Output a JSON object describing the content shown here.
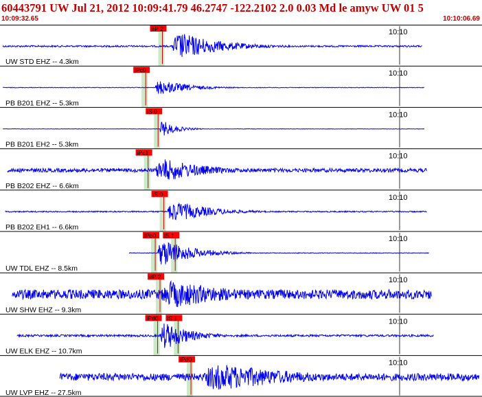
{
  "header": {
    "title": "60443791 UW Jul 21, 2012 10:09:41.79   46.2747 -122.2102  2.0 0.03 Md le amyw UW 01    5",
    "time_start": "10:09:32.65",
    "time_end": "10:10:06.69"
  },
  "colors": {
    "trace": "#0000ee",
    "pick_label_bg": "#ff0000",
    "pick_line": "#cc0000",
    "window_shading": "#cde8c8",
    "title_text": "#c00000",
    "panel_border": "#000000"
  },
  "tick_label": "10:10",
  "traces": [
    {
      "station": "UW STD EHZ -- 4.3km",
      "picks": [
        {
          "label": "eP 2",
          "t": 0.335
        }
      ],
      "onset": 0.355,
      "coda_end": 0.62,
      "quake_amp": 1.0,
      "noise_amp": 0.08,
      "trace_start": 0.0,
      "trace_end": 0.88
    },
    {
      "station": "PB B201 EHZ -- 5.3km",
      "picks": [
        {
          "label": "iPc0",
          "t": 0.3
        }
      ],
      "onset": 0.32,
      "coda_end": 0.5,
      "quake_amp": 0.55,
      "noise_amp": 0.03,
      "trace_start": 0.0,
      "trace_end": 0.885
    },
    {
      "station": "PB B201 EH2 -- 5.3km",
      "picks": [
        {
          "label": "iS 0",
          "t": 0.326
        }
      ],
      "onset": 0.33,
      "coda_end": 0.42,
      "quake_amp": 0.6,
      "noise_amp": 0.02,
      "trace_start": 0.0,
      "trace_end": 0.885
    },
    {
      "station": "PB B202 EHZ -- 6.6km",
      "picks": [
        {
          "label": "iPc1",
          "t": 0.305
        }
      ],
      "onset": 0.32,
      "coda_end": 0.6,
      "quake_amp": 0.85,
      "noise_amp": 0.18,
      "trace_start": 0.01,
      "trace_end": 0.89
    },
    {
      "station": "PB B202 EH1 -- 6.6km",
      "picks": [
        {
          "label": "iS 0",
          "t": 0.338
        }
      ],
      "onset": 0.345,
      "coda_end": 0.58,
      "quake_amp": 0.75,
      "noise_amp": 0.06,
      "trace_start": 0.005,
      "trace_end": 0.89
    },
    {
      "station": "UW TDL EHZ -- 8.5km",
      "picks": [
        {
          "label": "iPd0",
          "t": 0.32
        },
        {
          "label": "iS 1",
          "t": 0.362
        }
      ],
      "onset": 0.325,
      "coda_end": 0.52,
      "quake_amp": 1.0,
      "noise_amp": 0.03,
      "trace_start": 0.265,
      "trace_end": 0.895
    },
    {
      "station": "UW SHW EHZ -- 9.3km",
      "picks": [
        {
          "label": "eP 2",
          "t": 0.33
        }
      ],
      "onset": 0.33,
      "coda_end": 0.75,
      "quake_amp": 1.0,
      "noise_amp": 0.45,
      "trace_start": 0.02,
      "trace_end": 0.9
    },
    {
      "station": "UW ELK EHZ -- 10.7km",
      "picks": [
        {
          "label": "iPd0",
          "t": 0.325
        },
        {
          "label": "iS 1",
          "t": 0.368
        }
      ],
      "onset": 0.33,
      "coda_end": 0.5,
      "quake_amp": 1.0,
      "noise_amp": 0.1,
      "trace_start": 0.03,
      "trace_end": 0.905
    },
    {
      "station": "UW LVP EHZ -- 27.5km",
      "picks": [
        {
          "label": "iPd0",
          "t": 0.395
        }
      ],
      "onset": 0.42,
      "coda_end": 0.95,
      "quake_amp": 1.0,
      "noise_amp": 0.35,
      "trace_start": 0.12,
      "trace_end": 1.0
    }
  ]
}
